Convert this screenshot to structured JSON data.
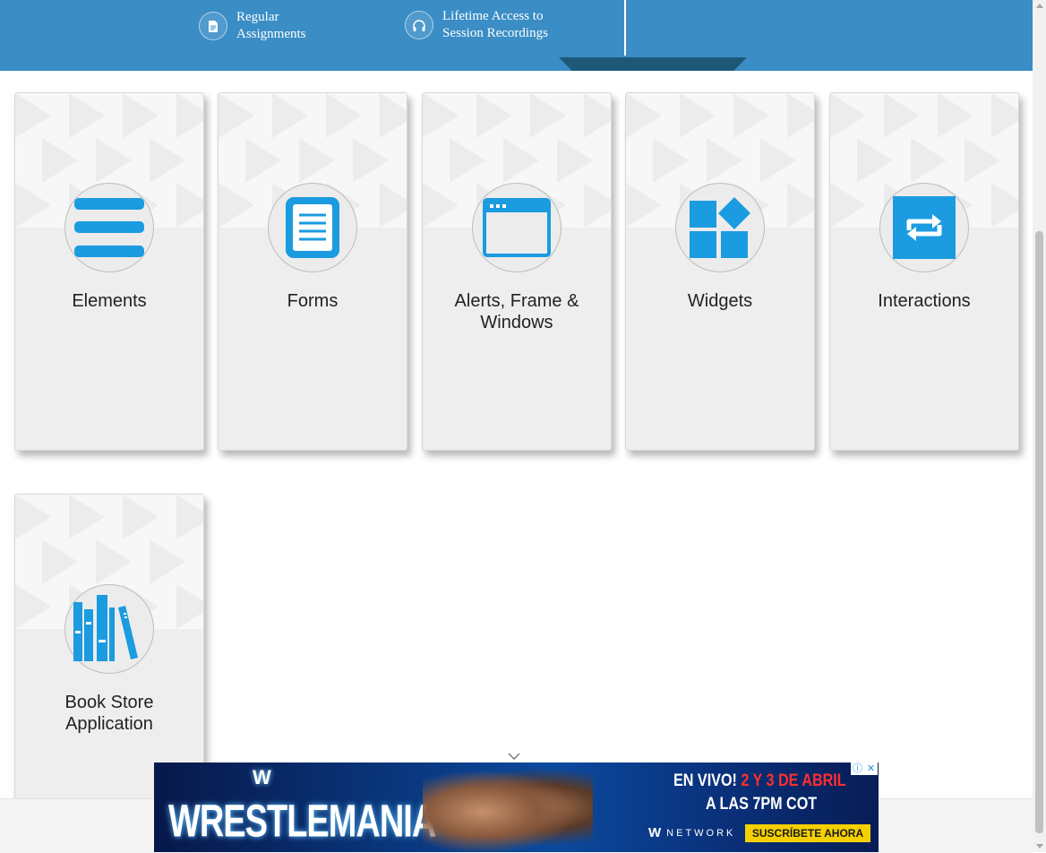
{
  "banner": {
    "features": [
      {
        "icon": "document-icon",
        "line1": "Regular",
        "line2": "Assignments"
      },
      {
        "icon": "headphones-icon",
        "line1": "Lifetime Access to",
        "line2": "Session Recordings"
      }
    ]
  },
  "cards": [
    {
      "title": "Elements",
      "icon": "menu-lines-icon"
    },
    {
      "title": "Forms",
      "icon": "form-document-icon"
    },
    {
      "title": "Alerts, Frame &\nWindows",
      "icon": "browser-window-icon"
    },
    {
      "title": "Widgets",
      "icon": "widgets-blocks-icon"
    },
    {
      "title": "Interactions",
      "icon": "repeat-arrows-icon"
    },
    {
      "title": "Book Store\nApplication",
      "icon": "books-icon"
    }
  ],
  "ad": {
    "brand": "WRESTLEMANIA",
    "headline_prefix": "EN VIVO!",
    "headline_dates": "2 Y 3 DE ABRIL",
    "headline_time": "A LAS 7PM COT",
    "network": "NETWORK",
    "cta": "SUSCRÍBETE AHORA"
  },
  "colors": {
    "banner": "#3a8dc5",
    "tab_accent": "#1d5878",
    "icon_blue": "#1b9be0",
    "card_bg": "#eeeeee"
  }
}
